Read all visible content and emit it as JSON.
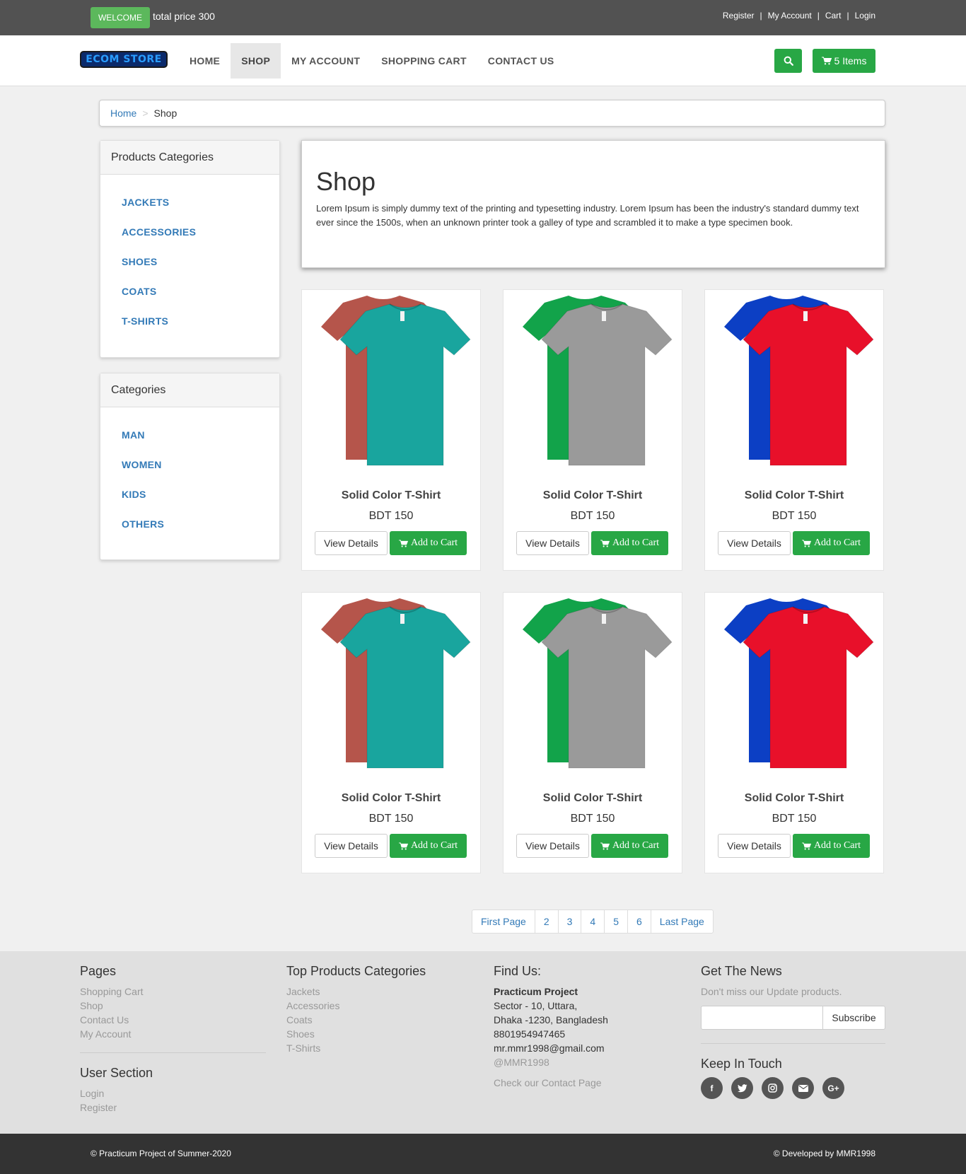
{
  "topbar": {
    "welcome": "WELCOME",
    "total_price": "total price 300",
    "links": [
      "Register",
      "My Account",
      "Cart",
      "Login"
    ]
  },
  "navbar": {
    "logo": "ECOM STORE",
    "items": [
      "HOME",
      "SHOP",
      "MY ACCOUNT",
      "SHOPPING CART",
      "CONTACT US"
    ],
    "active": "SHOP",
    "cart_label": "5 Items",
    "icons": {
      "search": "search-icon",
      "cart": "shopping-cart-icon"
    }
  },
  "breadcrumb": {
    "home": "Home",
    "separator": ">",
    "current": "Shop"
  },
  "sidebar": {
    "products_categories": {
      "title": "Products Categories",
      "items": [
        "JACKETS",
        "ACCESSORIES",
        "SHOES",
        "COATS",
        "T-SHIRTS"
      ]
    },
    "categories": {
      "title": "Categories",
      "items": [
        "MAN",
        "WOMEN",
        "KIDS",
        "OTHERS"
      ]
    }
  },
  "shop": {
    "title": "Shop",
    "description": "Lorem Ipsum is simply dummy text of the printing and typesetting industry. Lorem Ipsum has been the industry's standard dummy text ever since the 1500s, when an unknown printer took a galley of type and scrambled it to make a type specimen book."
  },
  "products": [
    {
      "title": "Solid Color T-Shirt",
      "price": "BDT 150",
      "view": "View Details",
      "add": "Add to Cart",
      "back_color": "#b5554b",
      "front_color": "#19a59e"
    },
    {
      "title": "Solid Color T-Shirt",
      "price": "BDT 150",
      "view": "View Details",
      "add": "Add to Cart",
      "back_color": "#12a34a",
      "front_color": "#9a9a9a"
    },
    {
      "title": "Solid Color T-Shirt",
      "price": "BDT 150",
      "view": "View Details",
      "add": "Add to Cart",
      "back_color": "#0c3fc4",
      "front_color": "#e8102a"
    },
    {
      "title": "Solid Color T-Shirt",
      "price": "BDT 150",
      "view": "View Details",
      "add": "Add to Cart",
      "back_color": "#b5554b",
      "front_color": "#19a59e"
    },
    {
      "title": "Solid Color T-Shirt",
      "price": "BDT 150",
      "view": "View Details",
      "add": "Add to Cart",
      "back_color": "#12a34a",
      "front_color": "#9a9a9a"
    },
    {
      "title": "Solid Color T-Shirt",
      "price": "BDT 150",
      "view": "View Details",
      "add": "Add to Cart",
      "back_color": "#0c3fc4",
      "front_color": "#e8102a"
    }
  ],
  "pagination": [
    "First Page",
    "2",
    "3",
    "4",
    "5",
    "6",
    "Last Page"
  ],
  "footer": {
    "pages": {
      "title": "Pages",
      "links": [
        "Shopping Cart",
        "Shop",
        "Contact Us",
        "My Account"
      ]
    },
    "user_section": {
      "title": "User Section",
      "links": [
        "Login",
        "Register"
      ]
    },
    "top_categories": {
      "title": "Top Products Categories",
      "links": [
        "Jackets",
        "Accessories",
        "Coats",
        "Shoes",
        "T-Shirts"
      ]
    },
    "find_us": {
      "title": "Find Us:",
      "name": "Practicum Project",
      "address1": "Sector - 10, Uttara,",
      "address2": "Dhaka -1230, Bangladesh",
      "phone": "8801954947465",
      "email": "mr.mmr1998@gmail.com",
      "handle": "@MMR1998",
      "contact_link": "Check our Contact Page"
    },
    "news": {
      "title": "Get The News",
      "text": "Don't miss our Update products.",
      "subscribe": "Subscribe",
      "keep_in_touch": "Keep In Touch",
      "social_icons": [
        "facebook-icon",
        "twitter-icon",
        "instagram-icon",
        "envelope-icon",
        "google-plus-icon"
      ]
    }
  },
  "bottom": {
    "left": "© Practicum Project of Summer-2020",
    "right": "© Developed by MMR1998"
  },
  "colors": {
    "accent_green": "#28a745",
    "welcome_green": "#5cb85c",
    "link_blue": "#337ab7",
    "topbar": "#525252",
    "bottombar": "#333333"
  }
}
